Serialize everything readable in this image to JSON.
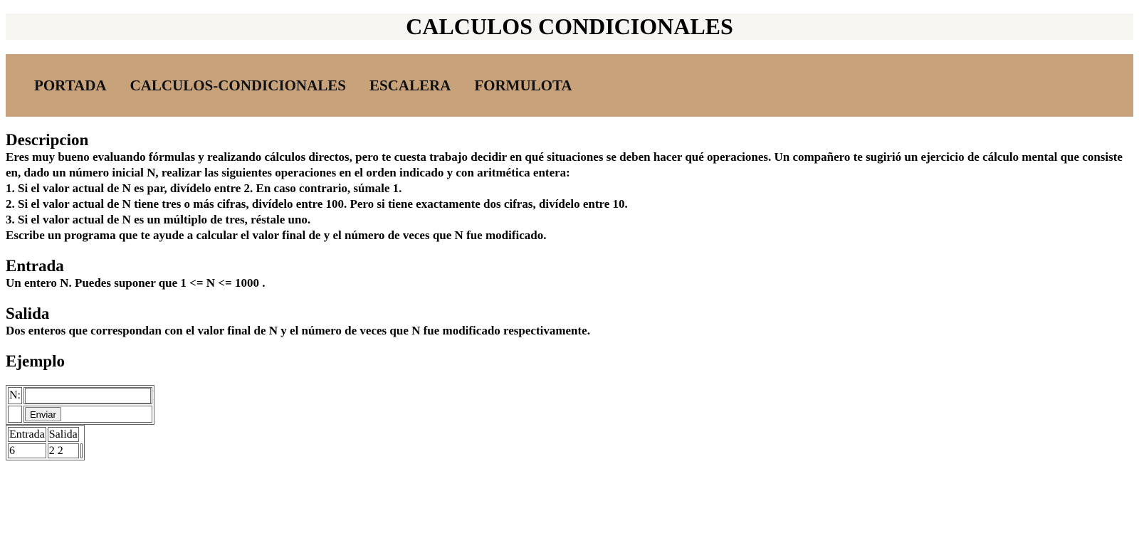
{
  "header": {
    "title": "CALCULOS CONDICIONALES"
  },
  "nav": {
    "items": [
      {
        "label": "PORTADA"
      },
      {
        "label": "CALCULOS-CONDICIONALES"
      },
      {
        "label": "ESCALERA"
      },
      {
        "label": "FORMULOTA"
      }
    ]
  },
  "descripcion": {
    "heading": "Descripcion",
    "paragraph": "Eres muy bueno evaluando fórmulas y realizando cálculos directos, pero te cuesta trabajo decidir en qué situaciones se deben hacer qué operaciones. Un compañero te sugirió un ejercicio de cálculo mental que consiste en, dado un número inicial N, realizar las siguientes operaciones en el orden indicado y con aritmética entera:",
    "step1": "1. Si el valor actual de N es par, divídelo entre 2. En caso contrario, súmale 1.",
    "step2": "2. Si el valor actual de N tiene tres o más cifras, divídelo entre 100. Pero si tiene exactamente dos cifras, divídelo entre 10.",
    "step3": "3. Si el valor actual de N es un múltiplo de tres, réstale uno.",
    "closing": "Escribe un programa que te ayude a calcular el valor final de y el número de veces que N fue modificado."
  },
  "entrada": {
    "heading": "Entrada",
    "text": "Un entero N. Puedes suponer que 1 <= N <= 1000 ."
  },
  "salida": {
    "heading": "Salida",
    "text": "Dos enteros que correspondan con el valor final de N y el número de veces que N fue modificado respectivamente."
  },
  "ejemplo": {
    "heading": "Ejemplo",
    "form": {
      "n_label": "N:",
      "n_value": "",
      "send_label": "Enviar"
    },
    "results": {
      "headers": [
        "Entrada",
        "Salida"
      ],
      "rows": [
        [
          "6",
          "2 2"
        ]
      ]
    }
  }
}
